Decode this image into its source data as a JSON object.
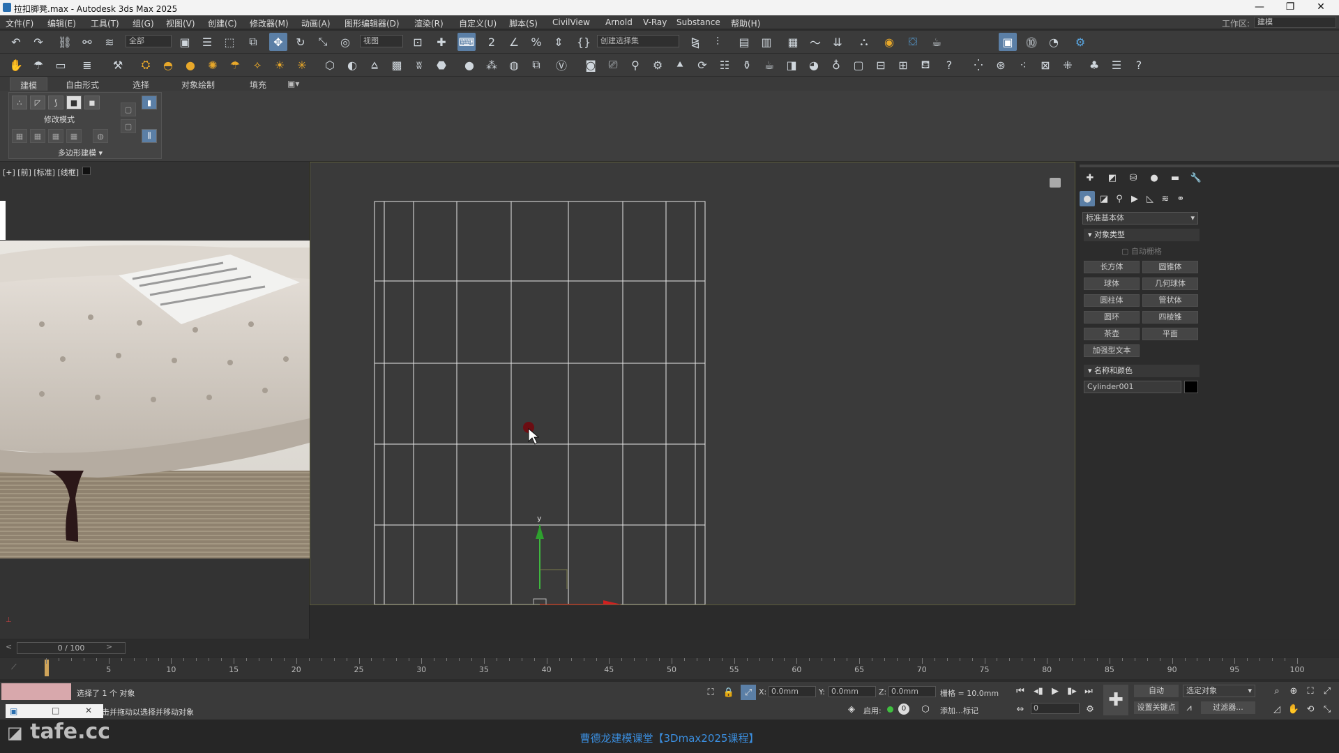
{
  "window": {
    "title": "拉扣脚凳.max - Autodesk 3ds Max 2025",
    "minimize": "—",
    "maximize": "❐",
    "close": "✕"
  },
  "menu": [
    "文件(F)",
    "编辑(E)",
    "工具(T)",
    "组(G)",
    "视图(V)",
    "创建(C)",
    "修改器(M)",
    "动画(A)",
    "图形编辑器(D)",
    "渲染(R)",
    "自定义(U)",
    "脚本(S)",
    "CivilView",
    "Arnold",
    "V-Ray",
    "Substance",
    "帮助(H)"
  ],
  "workspace": {
    "label": "工作区:",
    "value": "建模"
  },
  "toolbar": {
    "filter": "全部",
    "refcoord": "视图",
    "selset": "创建选择集"
  },
  "ribbon": {
    "tabs": [
      "建模",
      "自由形式",
      "选择",
      "对象绘制",
      "填充"
    ],
    "modify_mode": "修改模式",
    "poly_modeling": "多边形建模"
  },
  "viewport": {
    "label": "[+] [前] [标准] [线框]"
  },
  "command_panel": {
    "category": "标准基本体",
    "object_type_header": "对象类型",
    "autogrid": "自动栅格",
    "buttons": [
      "长方体",
      "圆锥体",
      "球体",
      "几何球体",
      "圆柱体",
      "管状体",
      "圆环",
      "四棱锥",
      "茶壶",
      "平面",
      "加强型文本"
    ],
    "name_color_header": "名称和颜色",
    "object_name": "Cylinder001",
    "object_color": "#000000"
  },
  "timeline": {
    "frame_display": "0 / 100",
    "ticks": [
      0,
      5,
      10,
      15,
      20,
      25,
      30,
      35,
      40,
      45,
      50,
      55,
      60,
      65,
      70,
      75,
      80,
      85,
      90,
      95,
      100
    ]
  },
  "status": {
    "selection": "选择了 1 个 对象",
    "prompt": "单击并拖动以选择并移动对象",
    "x_label": "X:",
    "x": "0.0mm",
    "y_label": "Y:",
    "y": "0.0mm",
    "z_label": "Z:",
    "z": "0.0mm",
    "grid": "栅格 = 10.0mm",
    "enable": "启用:",
    "add_tag": "添加…标记",
    "auto": "自动",
    "selected": "选定对象",
    "set_key": "设置关键点",
    "filters": "过滤器...",
    "frame": "0"
  },
  "footer": {
    "watermark_left": "tafe.cc",
    "course": "曹德龙建模课堂【3Dmax2025课程】"
  },
  "axis": {
    "y": "y"
  }
}
